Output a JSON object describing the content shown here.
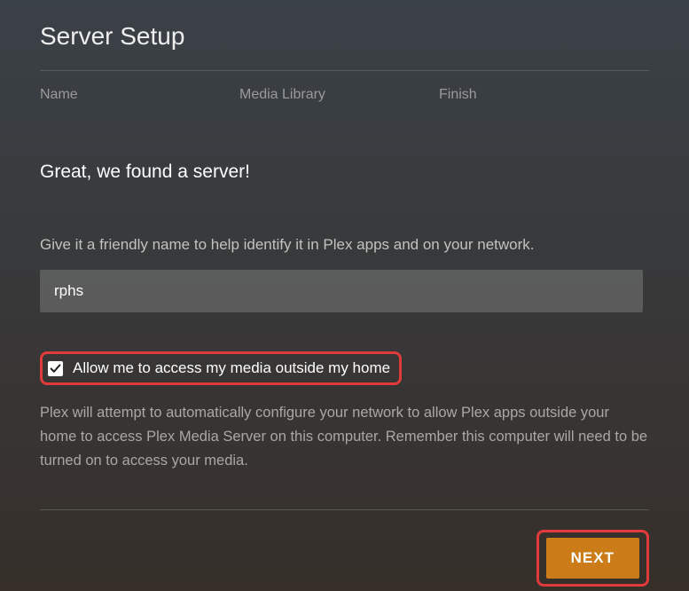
{
  "page_title": "Server Setup",
  "steps": [
    {
      "label": "Name"
    },
    {
      "label": "Media Library"
    },
    {
      "label": "Finish"
    }
  ],
  "headline": "Great, we found a server!",
  "instruction": "Give it a friendly name to help identify it in Plex apps and on your network.",
  "server_name_input": {
    "value": "rphs"
  },
  "remote_access": {
    "checked": true,
    "label": "Allow me to access my media outside my home",
    "help_text": "Plex will attempt to automatically configure your network to allow Plex apps outside your home to access Plex Media Server on this computer. Remember this computer will need to be turned on to access your media."
  },
  "next_button": {
    "label": "NEXT"
  },
  "colors": {
    "accent": "#cc7b19",
    "highlight_border": "#e03a3a"
  }
}
